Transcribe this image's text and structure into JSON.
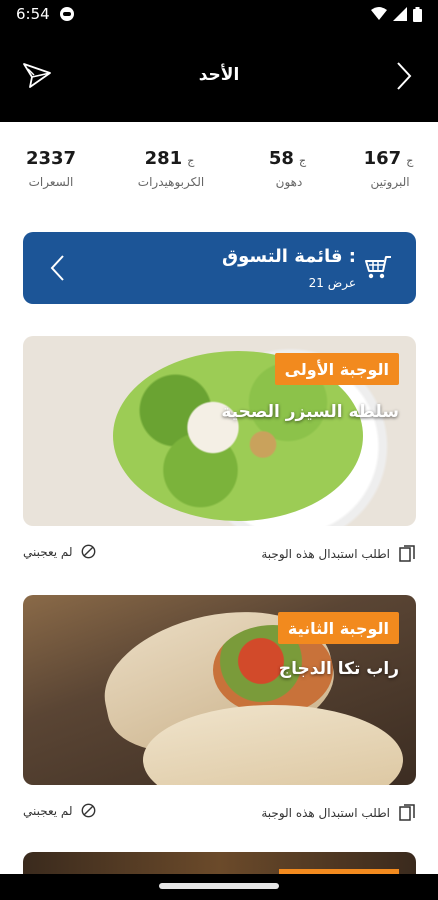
{
  "status": {
    "time": "6:54"
  },
  "header": {
    "title": "الأحد"
  },
  "macros": [
    {
      "value": "167",
      "unit": "ج",
      "label": "البروتين"
    },
    {
      "value": "58",
      "unit": "ج",
      "label": "دهون"
    },
    {
      "value": "281",
      "unit": "ج",
      "label": "الكربوهيدرات"
    },
    {
      "value": "2337",
      "unit": "",
      "label": "السعرات"
    }
  ],
  "shopping": {
    "title": "قائمة التسوق :",
    "subtitle": "21 عرض"
  },
  "meals": [
    {
      "tag": "الوجبة الأولى",
      "name": "سلطه السيزر الصحية"
    },
    {
      "tag": "الوجبة الثانية",
      "name": "راب تكا الدجاج"
    }
  ],
  "actions": {
    "replace_label": "اطلب استبدال هذه الوجبة",
    "dislike_label": "لم يعجبني"
  },
  "colors": {
    "primary": "#1c5597",
    "accent": "#f28a1e",
    "bar": "#000000"
  }
}
